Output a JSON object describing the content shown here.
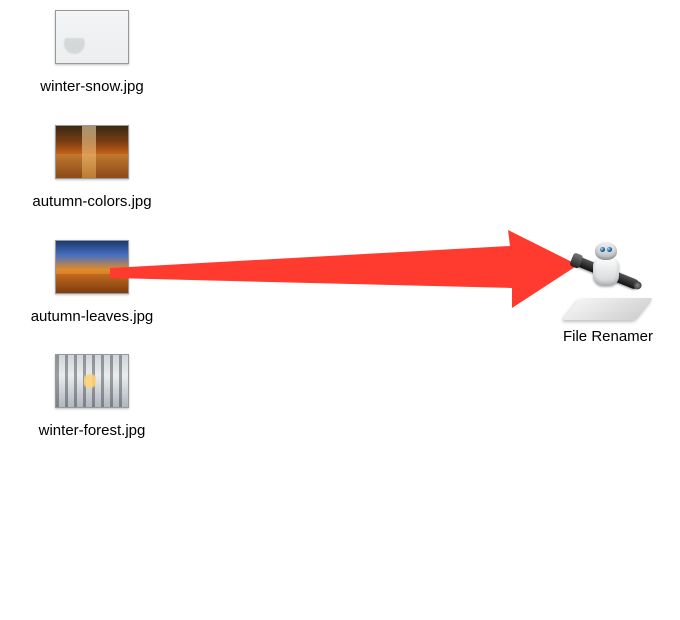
{
  "files": [
    {
      "name": "winter-snow.jpg",
      "thumb": "t-winter-snow"
    },
    {
      "name": "autumn-colors.jpg",
      "thumb": "t-autumn-colors"
    },
    {
      "name": "autumn-leaves.jpg",
      "thumb": "t-autumn-leaves"
    },
    {
      "name": "winter-forest.jpg",
      "thumb": "t-winter-forest"
    }
  ],
  "app": {
    "label": "File Renamer",
    "icon": "automator-icon"
  },
  "arrow": {
    "color": "#ff3b2f"
  }
}
